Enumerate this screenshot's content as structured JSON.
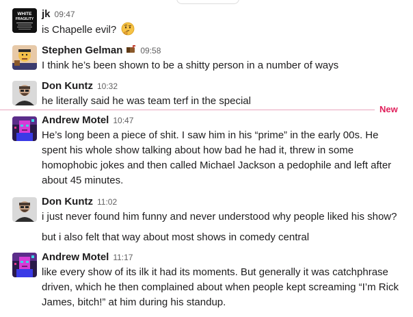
{
  "messages": [
    {
      "author": "jk",
      "time": "09:47",
      "avatar": "white-fragility-book-cover",
      "text": [
        "is Chapelle evil?"
      ],
      "emoji": "thinking-face"
    },
    {
      "author": "Stephen Gelman",
      "time": "09:58",
      "avatar": "cartoon-character-avatar",
      "status_icon": "mailbox-status-icon",
      "text": [
        "I think he’s been shown to be a shitty person in a number of ways"
      ]
    },
    {
      "author": "Don Kuntz",
      "time": "10:32",
      "avatar": "photo-avatar",
      "text": [
        "he literally said he was team terf in the special"
      ]
    },
    {
      "author": "Andrew Motel",
      "time": "10:47",
      "avatar": "pixel-art-avatar",
      "text": [
        "He’s long been a piece of shit. I saw him in his “prime” in the early 00s. He spent his whole show talking about how bad he had it, threw in some homophobic jokes and then called Michael Jackson a pedophile and left after about 45 minutes."
      ]
    },
    {
      "author": "Don Kuntz",
      "time": "11:02",
      "avatar": "photo-avatar",
      "text": [
        "i just never found him funny and never understood why people liked his show?",
        "but i also felt that way about most shows in comedy central"
      ]
    },
    {
      "author": "Andrew Motel",
      "time": "11:17",
      "avatar": "pixel-art-avatar",
      "text": [
        "like every show of its ilk it had its moments. But generally it was catchphrase driven, which he then complained about when people kept screaming “I’m Rick James, bitch!” at him during his standup."
      ]
    }
  ],
  "avatar_texts": {
    "book_line1": "WHITE",
    "book_line2": "FRAGILITY"
  },
  "divider": {
    "label": "New",
    "color": "#e01e5a"
  },
  "colors": {
    "text": "#1d1c1d",
    "timestamp": "#616061",
    "new_divider": "#e01e5a"
  }
}
